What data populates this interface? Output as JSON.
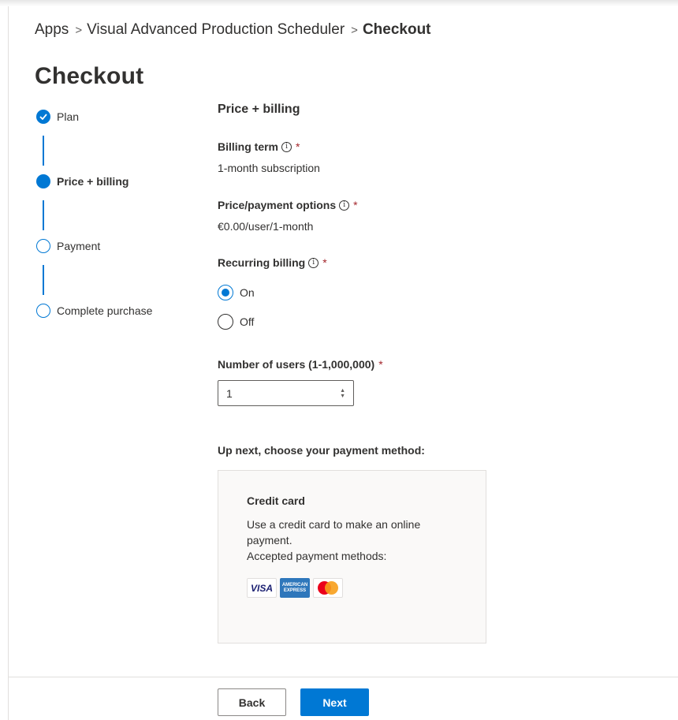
{
  "breadcrumb": {
    "items": [
      "Apps",
      "Visual Advanced Production Scheduler"
    ],
    "current": "Checkout",
    "separator": ">"
  },
  "page_title": "Checkout",
  "steps": [
    {
      "label": "Plan",
      "state": "done"
    },
    {
      "label": "Price + billing",
      "state": "current"
    },
    {
      "label": "Payment",
      "state": "todo"
    },
    {
      "label": "Complete purchase",
      "state": "todo"
    }
  ],
  "section_title": "Price + billing",
  "billing_term": {
    "label": "Billing term",
    "value": "1-month subscription"
  },
  "price_options": {
    "label": "Price/payment options",
    "value": "€0.00/user/1-month"
  },
  "recurring": {
    "label": "Recurring billing",
    "on_label": "On",
    "off_label": "Off",
    "selected": "On"
  },
  "users": {
    "label": "Number of users (1-1,000,000)",
    "value": "1"
  },
  "required_mark": "*",
  "next_heading": "Up next, choose your payment method:",
  "payment_card": {
    "title": "Credit card",
    "description": "Use a credit card to make an online payment.",
    "accepted": "Accepted payment methods:",
    "logos": {
      "visa": "VISA",
      "amex_line1": "AMERICAN",
      "amex_line2": "EXPRESS"
    }
  },
  "buttons": {
    "back": "Back",
    "next": "Next"
  },
  "colors": {
    "accent": "#0078d4",
    "required": "#a4262c",
    "text": "#323130"
  }
}
